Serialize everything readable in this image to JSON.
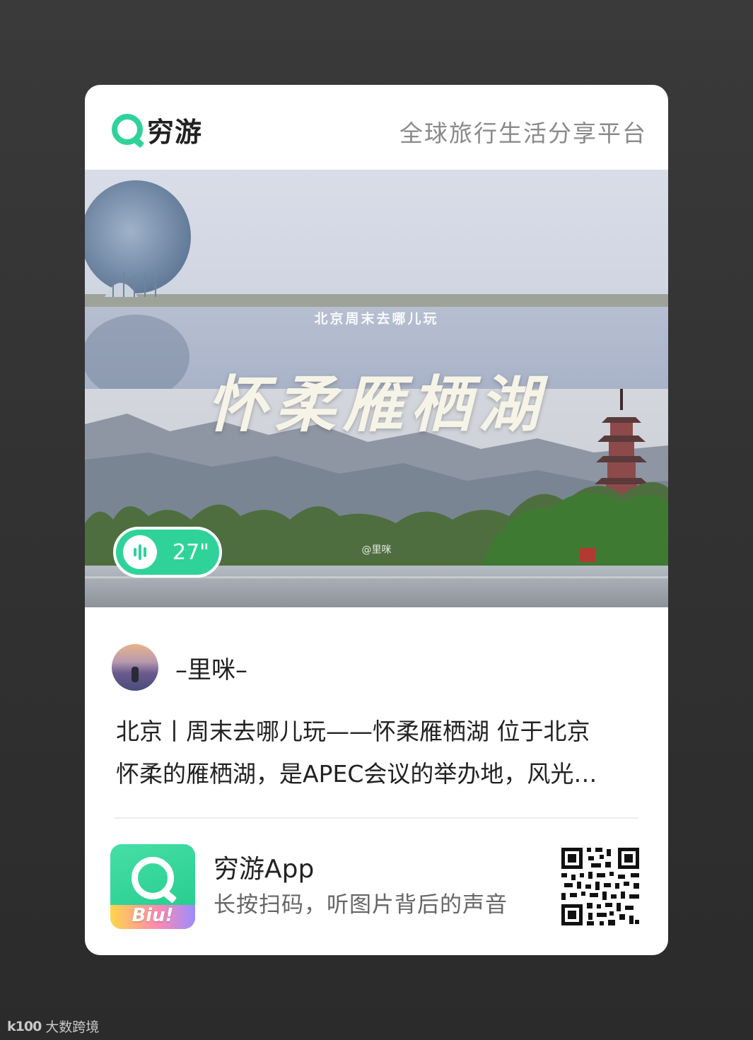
{
  "header": {
    "logo_text": "穷游",
    "slogan": "全球旅行生活分享平台"
  },
  "post": {
    "photo": {
      "subtitle": "北京周末去哪儿玩",
      "title": "怀柔雁栖湖",
      "credit": "@里咪"
    },
    "audio": {
      "duration": "27\""
    },
    "author": {
      "name": "–里咪–"
    },
    "description": [
      "北京丨周末去哪儿玩——怀柔雁栖湖 位于北京",
      "怀柔的雁栖湖，是APEC会议的举办地，风光…"
    ]
  },
  "footer": {
    "app_name": "穷游App",
    "app_icon_text": "Biu!",
    "tip": "长按扫码，听图片背后的声音"
  },
  "watermark": {
    "mark": "k100",
    "text": "大数跨境"
  },
  "colors": {
    "brand_green": "#2fd39a",
    "text_dark": "#222222",
    "text_gray": "#8a8a8a"
  }
}
